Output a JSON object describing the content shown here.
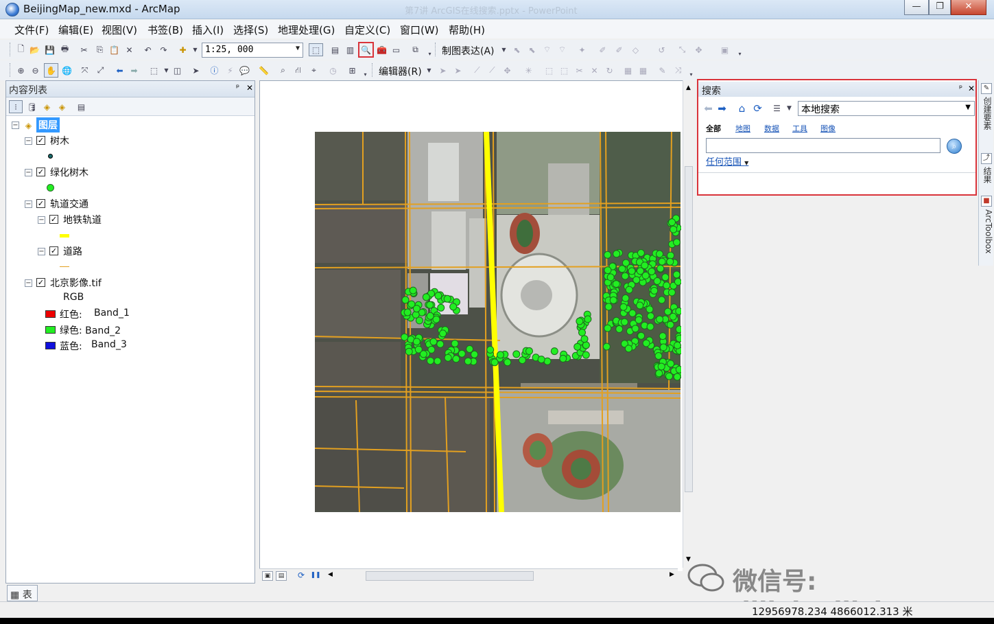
{
  "window": {
    "title": "BeijingMap_new.mxd - ArcMap",
    "ghost_title": "第7讲 ArcGIS在线搜索.pptx - PowerPoint",
    "min": "—",
    "max": "❐",
    "close": "✕"
  },
  "menu": [
    "文件(F)",
    "编辑(E)",
    "视图(V)",
    "书签(B)",
    "插入(I)",
    "选择(S)",
    "地理处理(G)",
    "自定义(C)",
    "窗口(W)",
    "帮助(H)"
  ],
  "toolbar": {
    "scale": "1:25, 000",
    "cartography_label": "制图表达(A)",
    "editor_label": "编辑器(R)"
  },
  "toc": {
    "title": "内容列表",
    "pin": "ᵖ",
    "close": "✕",
    "root": "图层",
    "layers": {
      "trees": "树木",
      "green_trees": "绿化树木",
      "rail_group": "轨道交通",
      "subway": "地铁轨道",
      "roads": "道路",
      "image": "北京影像.tif",
      "rgb": "RGB",
      "red": "红色:",
      "red_band": "Band_1",
      "green": "绿色: Band_2",
      "blue": "蓝色:",
      "blue_band": "Band_3"
    }
  },
  "bottom_tab": "表",
  "search": {
    "title": "搜索",
    "pin": "ᵖ",
    "close": "✕",
    "scope": "本地搜索",
    "tabs": [
      "全部",
      "地图",
      "数据",
      "工具",
      "图像"
    ],
    "extent": "任何范围",
    "input_value": ""
  },
  "dock": {
    "create_features": "创建要素",
    "results": "结果",
    "toolbox": "ArcToolbox"
  },
  "status": {
    "coords": "12956978.234  4866012.313 米"
  },
  "watermark": "微信号: dilixinxijishu",
  "colors": {
    "highlight": "#d9333a",
    "subway": "#ffff00",
    "roads": "#e3a020",
    "green_trees": "#22ee22"
  }
}
